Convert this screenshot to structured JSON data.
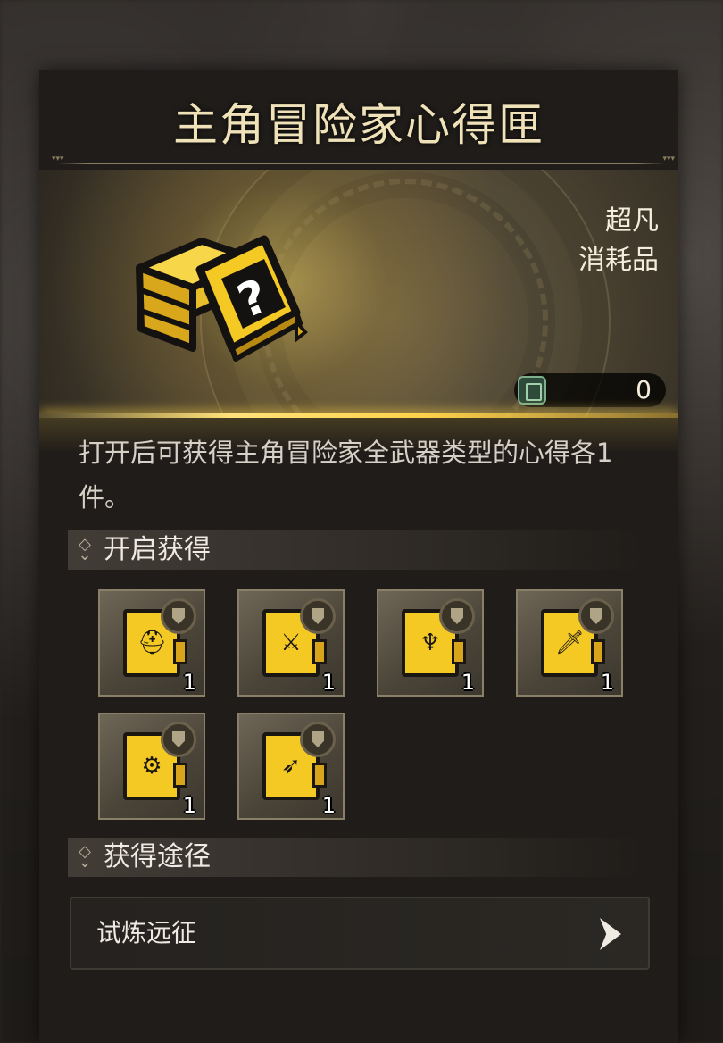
{
  "panel": {
    "title": "主角冒险家心得匣"
  },
  "item": {
    "rarity": "超凡",
    "category": "消耗品",
    "owned_count": "0",
    "icon": "mystery-box-icon",
    "description": "打开后可获得主角冒险家全武器类型的心得各1件。"
  },
  "sections": {
    "rewards_title": "开启获得",
    "sources_title": "获得途径"
  },
  "rewards": [
    {
      "icon": "helmet-book-icon",
      "glyph": "⛑",
      "qty": "1"
    },
    {
      "icon": "blade-book-icon",
      "glyph": "⚔",
      "qty": "1"
    },
    {
      "icon": "claw-book-icon",
      "glyph": "♆",
      "qty": "1"
    },
    {
      "icon": "sword-shield-book-icon",
      "glyph": "🗡",
      "qty": "1"
    },
    {
      "icon": "armor-book-icon",
      "glyph": "⚙",
      "qty": "1"
    },
    {
      "icon": "bow-book-icon",
      "glyph": "➶",
      "qty": "1"
    }
  ],
  "sources": [
    {
      "label": "试炼远征"
    }
  ],
  "colors": {
    "accent_gold": "#f4c924",
    "title_text": "#f0e2b8",
    "panel_bg": "#1f1c19"
  }
}
